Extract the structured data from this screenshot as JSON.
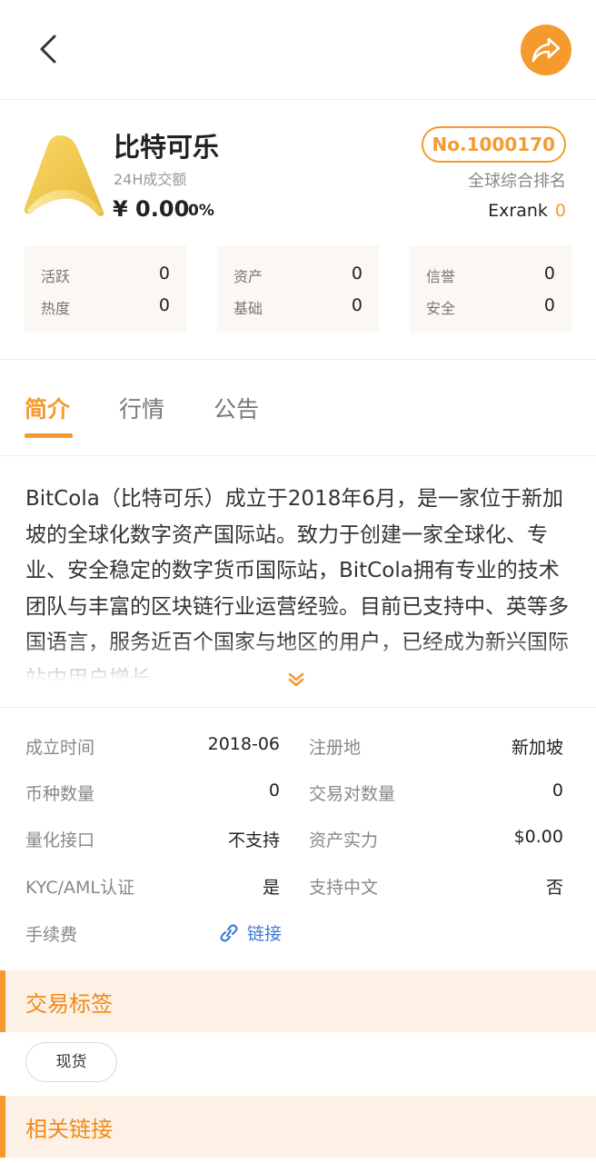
{
  "nav": {
    "back_icon": "chevron-left-icon",
    "share_icon": "share-arrow-icon"
  },
  "exchange": {
    "name": "比特可乐",
    "volume_label": "24H成交额",
    "volume_value": "¥ 0.00",
    "volume_change": "0%",
    "rank_badge": "No.1000170",
    "rank_label": "全球综合排名",
    "exrank_label": "Exrank",
    "exrank_value": "0"
  },
  "stats": [
    {
      "rows": [
        {
          "label": "活跃",
          "value": "0"
        },
        {
          "label": "热度",
          "value": "0"
        }
      ]
    },
    {
      "rows": [
        {
          "label": "资产",
          "value": "0"
        },
        {
          "label": "基础",
          "value": "0"
        }
      ]
    },
    {
      "rows": [
        {
          "label": "信誉",
          "value": "0"
        },
        {
          "label": "安全",
          "value": "0"
        }
      ]
    }
  ],
  "tabs": [
    {
      "label": "简介",
      "active": true
    },
    {
      "label": "行情",
      "active": false
    },
    {
      "label": "公告",
      "active": false
    }
  ],
  "intro": {
    "text": "BitCola（比特可乐）成立于2018年6月，是一家位于新加坡的全球化数字资产国际站。致力于创建一家全球化、专业、安全稳定的数字货币国际站，BitCola拥有专业的技术团队与丰富的区块链行业运营经验。目前已支持中、英等多国语言，服务近百个国家与地区的用户，已经成为新兴国际站中用户增长"
  },
  "info": {
    "founded_label": "成立时间",
    "founded_value": "2018-06",
    "region_label": "注册地",
    "region_value": "新加坡",
    "coins_label": "币种数量",
    "coins_value": "0",
    "pairs_label": "交易对数量",
    "pairs_value": "0",
    "api_label": "量化接口",
    "api_value": "不支持",
    "assets_label": "资产实力",
    "assets_value": "$0.00",
    "kyc_label": "KYC/AML认证",
    "kyc_value": "是",
    "chinese_label": "支持中文",
    "chinese_value": "否",
    "fee_label": "手续费",
    "fee_link": "链接"
  },
  "sections": {
    "tags_title": "交易标签",
    "links_title": "相关链接"
  },
  "tags": [
    "现货"
  ],
  "colors": {
    "accent": "#f59a2e",
    "link": "#3a7bd5",
    "section_bg": "#fdf1e6"
  }
}
